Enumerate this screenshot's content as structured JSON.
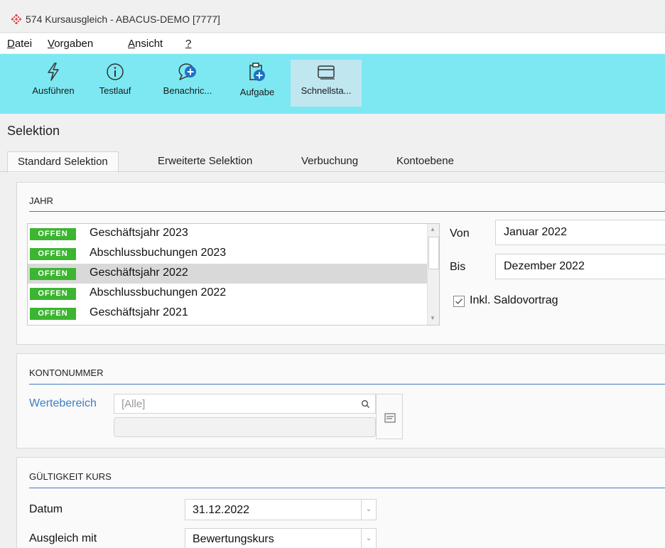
{
  "window": {
    "title": "574 Kursausgleich - ABACUS-DEMO [7777]",
    "logo_color": "#e0474c"
  },
  "menu": [
    {
      "label": "Datei"
    },
    {
      "label": "Vorgaben"
    },
    {
      "label": "Ansicht"
    },
    {
      "label": "?"
    }
  ],
  "toolbar": {
    "background": "#7de8f2",
    "buttons": [
      {
        "label": "Ausführen",
        "icon": "lightning-icon"
      },
      {
        "label": "Testlauf",
        "icon": "info-icon"
      },
      {
        "label": "Benachric...",
        "icon": "chat-add-icon"
      },
      {
        "label": "Aufgabe",
        "icon": "clipboard-add-icon"
      },
      {
        "label": "Schnellsta...",
        "icon": "window-icon"
      }
    ]
  },
  "section_title": "Selektion",
  "tabs": [
    {
      "label": "Standard Selektion",
      "active": true
    },
    {
      "label": "Erweiterte Selektion"
    },
    {
      "label": "Verbuchung"
    },
    {
      "label": "Kontoebene"
    }
  ],
  "jahr": {
    "title": "JAHR",
    "badge": "OFFEN",
    "badge_color": "#3cb531",
    "items": [
      {
        "label": "Geschäftsjahr 2023"
      },
      {
        "label": "Abschlussbuchungen 2023"
      },
      {
        "label": "Geschäftsjahr 2022",
        "selected": true
      },
      {
        "label": "Abschlussbuchungen 2022"
      },
      {
        "label": "Geschäftsjahr 2021"
      }
    ],
    "von_label": "Von",
    "von_value": "Januar 2022",
    "bis_label": "Bis",
    "bis_value": "Dezember 2022",
    "saldo_label": "Inkl. Saldovortrag",
    "saldo_checked": true
  },
  "konto": {
    "title": "KONTONUMMER",
    "range_label": "Wertebereich",
    "range_placeholder": "[Alle]",
    "accent_color": "#3e7fc1"
  },
  "kurs": {
    "title": "GÜLTIGKEIT KURS",
    "datum_label": "Datum",
    "datum_value": "31.12.2022",
    "ausgleich_label": "Ausgleich mit",
    "ausgleich_value": "Bewertungskurs"
  }
}
